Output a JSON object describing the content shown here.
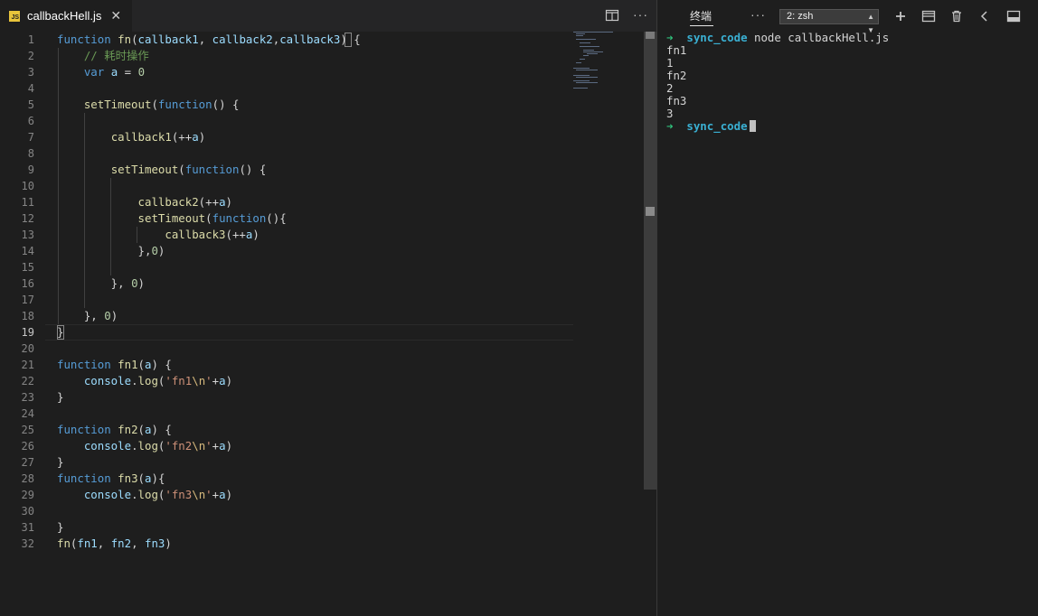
{
  "editor": {
    "tab": {
      "icon_text": "JS",
      "title": "callbackHell.js",
      "close": "✕"
    },
    "toolbar": {
      "split_icon": "split-editor-icon",
      "more": "···"
    },
    "line_numbers": [
      "1",
      "2",
      "3",
      "4",
      "5",
      "6",
      "7",
      "8",
      "9",
      "10",
      "11",
      "12",
      "13",
      "14",
      "15",
      "16",
      "17",
      "18",
      "19",
      "20",
      "21",
      "22",
      "23",
      "24",
      "25",
      "26",
      "27",
      "28",
      "29",
      "30",
      "31",
      "32"
    ],
    "active_line": 19
  },
  "terminal": {
    "title": "终端",
    "more": "···",
    "selected_terminal": "2: zsh",
    "prompt_arrow": "➜",
    "prompt_dir": "sync_code",
    "command": "node callbackHell.js",
    "output": [
      "fn1",
      "1",
      "fn2",
      "2",
      "fn3",
      "3"
    ],
    "icons": [
      "plus-icon",
      "split-icon",
      "trash-icon",
      "chevron-left-icon",
      "maximize-panel-icon"
    ]
  }
}
